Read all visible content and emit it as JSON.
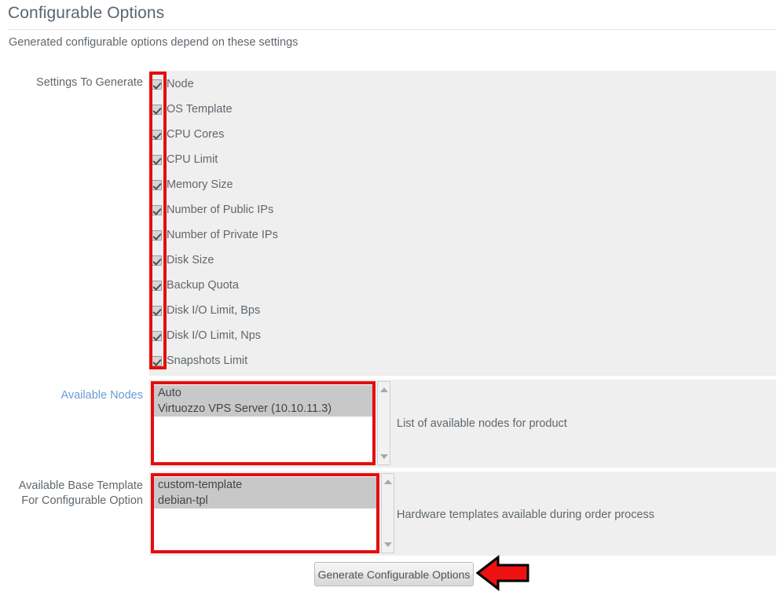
{
  "page": {
    "title": "Configurable Options",
    "subtitle": "Generated configurable options depend on these settings"
  },
  "settings_to_generate": {
    "label": "Settings To Generate",
    "items": [
      {
        "label": "Node",
        "checked": true
      },
      {
        "label": "OS Template",
        "checked": true
      },
      {
        "label": "CPU Cores",
        "checked": true
      },
      {
        "label": "CPU Limit",
        "checked": true
      },
      {
        "label": "Memory Size",
        "checked": true
      },
      {
        "label": "Number of Public IPs",
        "checked": true
      },
      {
        "label": "Number of Private IPs",
        "checked": true
      },
      {
        "label": "Disk Size",
        "checked": true
      },
      {
        "label": "Backup Quota",
        "checked": true
      },
      {
        "label": "Disk I/O Limit, Bps",
        "checked": true
      },
      {
        "label": "Disk I/O Limit, Nps",
        "checked": true
      },
      {
        "label": "Snapshots Limit",
        "checked": true
      }
    ]
  },
  "available_nodes": {
    "label": "Available Nodes",
    "help": "List of available nodes for product",
    "options": [
      {
        "label": "Auto",
        "selected": true
      },
      {
        "label": "Virtuozzo VPS Server (10.10.11.3)",
        "selected": true
      }
    ]
  },
  "available_base_template": {
    "label_line1": "Available Base Template",
    "label_line2": "For Configurable Option",
    "help": "Hardware templates available during order process",
    "options": [
      {
        "label": "custom-template",
        "selected": true
      },
      {
        "label": "debian-tpl",
        "selected": true
      }
    ]
  },
  "actions": {
    "generate_label": "Generate Configurable Options"
  },
  "colors": {
    "annotation_red": "#e60d0d",
    "panel_gray": "#efefef",
    "link_blue": "#6b9bd2",
    "selected_gray": "#c8c8c8"
  }
}
